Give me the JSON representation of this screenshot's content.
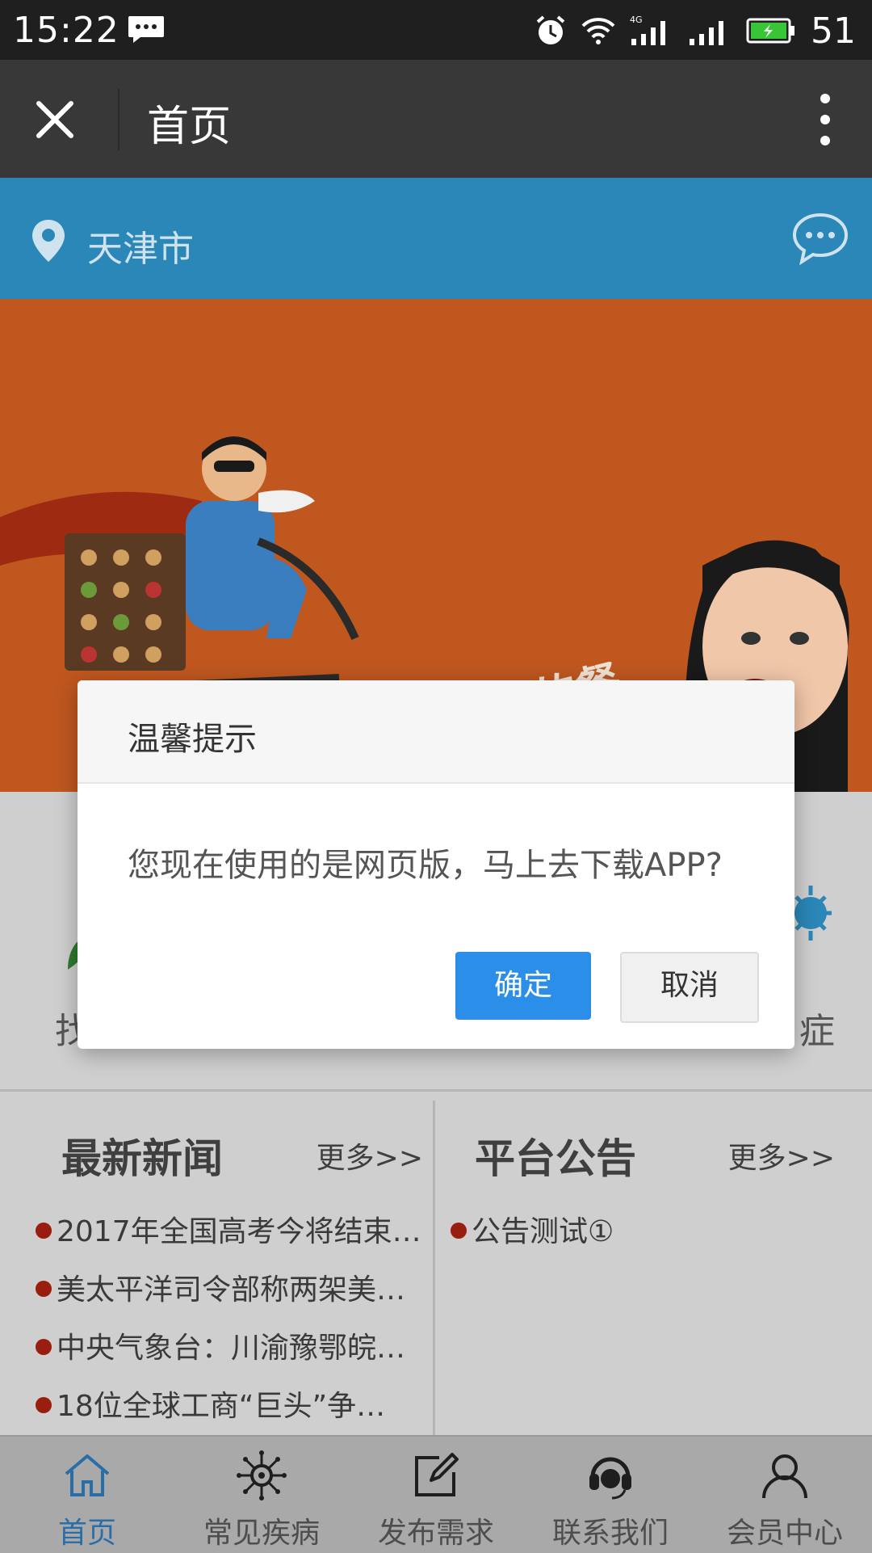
{
  "status_bar": {
    "time": "15:22",
    "battery": "51"
  },
  "title_bar": {
    "title": "首页"
  },
  "location_bar": {
    "city": "天津市"
  },
  "banner": {
    "caption": "老板，您点的餐"
  },
  "categories": {
    "left_partial": "找",
    "right_partial": "症"
  },
  "news": {
    "title": "最新新闻",
    "more": "更多>>",
    "items": [
      "2017年全国高考今将结束…",
      "美太平洋司令部称两架美…",
      "中央气象台：川渝豫鄂皖…",
      "18位全球工商“巨头”争…"
    ]
  },
  "notice": {
    "title": "平台公告",
    "more": "更多>>",
    "items": [
      "公告测试①"
    ]
  },
  "dialog": {
    "title": "温馨提示",
    "message": "您现在使用的是网页版，马上去下载APP?",
    "confirm": "确定",
    "cancel": "取消",
    "confirm_color": "#2b8ee8"
  },
  "tabs": [
    {
      "label": "首页",
      "icon": "home-icon",
      "active": true
    },
    {
      "label": "常见疾病",
      "icon": "virus-icon"
    },
    {
      "label": "发布需求",
      "icon": "edit-icon"
    },
    {
      "label": "联系我们",
      "icon": "headset-icon"
    },
    {
      "label": "会员中心",
      "icon": "user-icon"
    }
  ]
}
